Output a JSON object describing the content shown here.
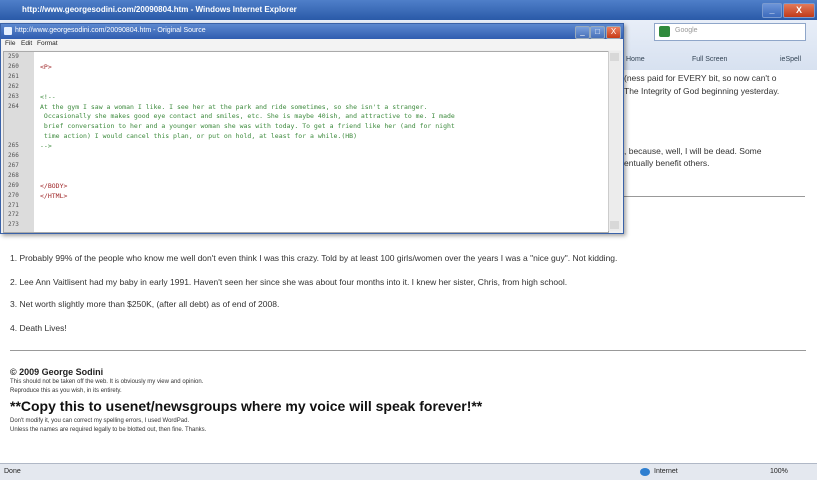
{
  "ie": {
    "title": "http://www.georgesodini.com/20090804.htm - Windows Internet Explorer",
    "search_placeholder": "Google",
    "cmd": {
      "home": "Home",
      "fullscreen": "Full Screen",
      "spell": "ieSpell"
    },
    "controls": {
      "min": "_",
      "max": "□",
      "close": "X"
    }
  },
  "page": {
    "frag1": "(ness paid for EVERY bit, so now can't o",
    "frag2": "The Integrity of God beginning yesterday.",
    "frag3": ", because, well, I will be dead. Some",
    "frag4": "entually benefit others.",
    "items": [
      "1. Probably 99% of the people who know me well don't even think I was this crazy. Told by at least 100 girls/women over the years I was a \"nice guy\". Not kidding.",
      "2. Lee Ann Vaitlisent had my baby in early 1991. Haven't seen her since she was about four months into it. I knew her sister, Chris, from high school.",
      "3. Net worth slightly more than $250K, (after all debt) as of end of 2008.",
      "4. Death Lives!"
    ],
    "copyright": "© 2009 George Sodini",
    "line1": "This should not be taken off the web. It is obviously my view and opinion.",
    "line2": "Reproduce this as you wish, in its entirety.",
    "big": "**Copy this to usenet/newsgroups where my voice will speak forever!**",
    "line3": "Don't modify it, you can correct my spelling errors, I used WordPad.",
    "line4": "Unless the names are required legally to be blotted out, then fine. Thanks."
  },
  "source": {
    "title": "http://www.georgesodini.com/20090804.htm - Original Source",
    "menu": [
      "File",
      "Edit",
      "Format"
    ],
    "lines": [
      {
        "n": "259",
        "code": ""
      },
      {
        "n": "260",
        "code": "<P>"
      },
      {
        "n": "261",
        "code": ""
      },
      {
        "n": "262",
        "code": ""
      },
      {
        "n": "263",
        "code": "<!--"
      },
      {
        "n": "264",
        "code": "At the gym I saw a woman I like. I see her at the park and ride sometimes, so she isn't a stranger."
      },
      {
        "n": "",
        "code": " Occasionally she makes good eye contact and smiles, etc. She is maybe 40ish, and attractive to me. I made"
      },
      {
        "n": "",
        "code": " brief conversation to her and a younger woman she was with today. To get a friend like her (and for night"
      },
      {
        "n": "",
        "code": " time action) I would cancel this plan, or put on hold, at least for a while.(HB)"
      },
      {
        "n": "265",
        "code": "-->"
      },
      {
        "n": "266",
        "code": ""
      },
      {
        "n": "267",
        "code": ""
      },
      {
        "n": "268",
        "code": ""
      },
      {
        "n": "269",
        "code": "</BODY>"
      },
      {
        "n": "270",
        "code": "</HTML>"
      },
      {
        "n": "271",
        "code": ""
      },
      {
        "n": "272",
        "code": ""
      },
      {
        "n": "273",
        "code": ""
      }
    ]
  },
  "status": {
    "left": "Done",
    "zone": "Internet",
    "zoom": "100%"
  },
  "colors": {
    "tag": "#a0282a",
    "comment": "#3c8a3c"
  }
}
